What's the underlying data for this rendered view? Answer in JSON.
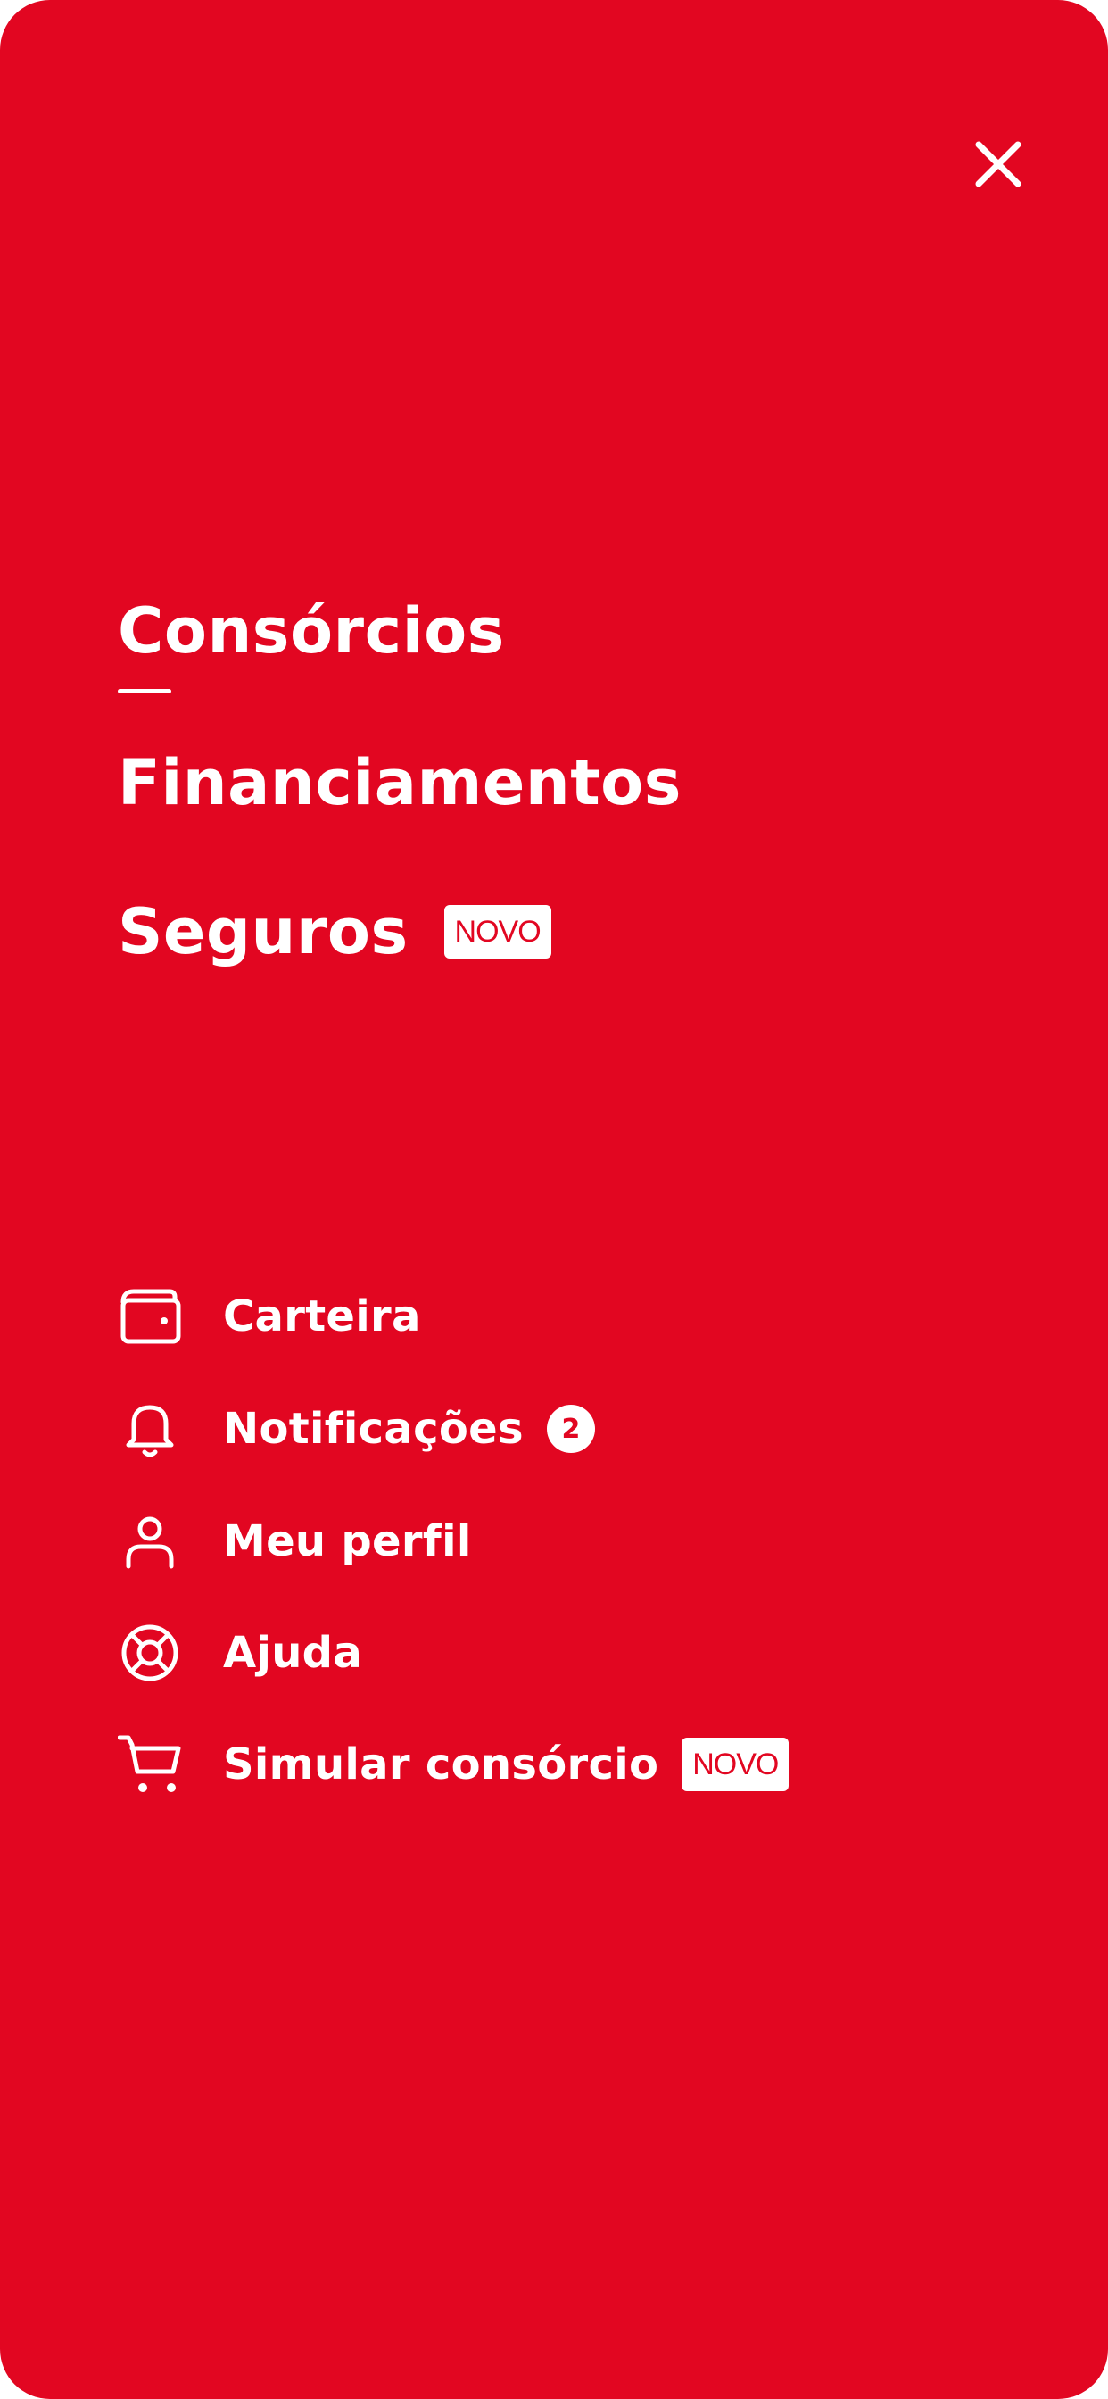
{
  "colors": {
    "background": "#E20621",
    "foreground": "#FFFFFF",
    "badge_text": "#E20621"
  },
  "close": {
    "icon": "close-icon"
  },
  "main_nav": {
    "items": [
      {
        "label": "Consórcios",
        "active": true
      },
      {
        "label": "Financiamentos"
      },
      {
        "label": "Seguros",
        "badge": "NOVO"
      }
    ]
  },
  "secondary_nav": {
    "items": [
      {
        "label": "Carteira",
        "icon": "wallet-icon"
      },
      {
        "label": "Notificações",
        "icon": "bell-icon",
        "count": "2"
      },
      {
        "label": "Meu perfil",
        "icon": "user-icon"
      },
      {
        "label": "Ajuda",
        "icon": "lifebuoy-icon"
      },
      {
        "label": "Simular consórcio",
        "icon": "cart-icon",
        "badge": "NOVO"
      }
    ]
  }
}
